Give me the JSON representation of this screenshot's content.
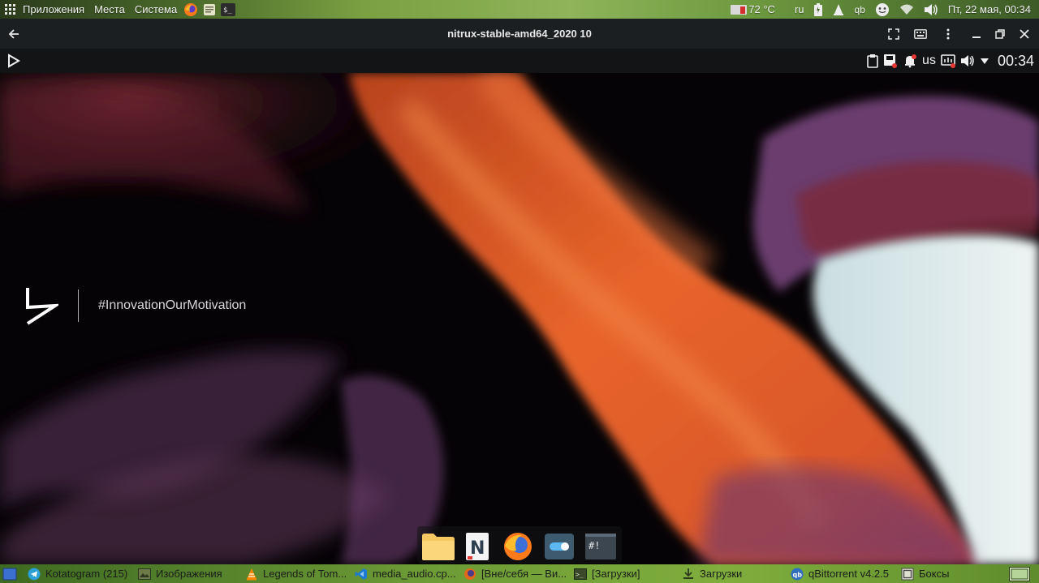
{
  "top_panel": {
    "menus": [
      "Приложения",
      "Места",
      "Система"
    ],
    "temperature": "72 °C",
    "keyboard_layout": "ru",
    "qbittorrent": "qb",
    "datetime": "Пт, 22 мая, 00:34"
  },
  "titlebar": {
    "title": "nitrux-stable-amd64_2020 10"
  },
  "guest_panel": {
    "keyboard_layout": "us",
    "clock": "00:34"
  },
  "desktop": {
    "tagline": "#InnovationOurMotivation"
  },
  "dock": {
    "items": [
      "folder",
      "notes",
      "firefox",
      "toggle",
      "terminal"
    ]
  },
  "taskbar": {
    "tasks": [
      {
        "label": "Kotatogram (215)",
        "icon": "telegram-icon"
      },
      {
        "label": "Изображения",
        "icon": "image-viewer-icon"
      },
      {
        "label": "Legends of Tom...",
        "icon": "vlc-icon"
      },
      {
        "label": "media_audio.cp...",
        "icon": "vscode-icon"
      },
      {
        "label": "[Вне/себя — Ви...",
        "icon": "firefox-icon"
      },
      {
        "label": "[Загрузки]",
        "icon": "terminal-icon"
      },
      {
        "label": "Загрузки",
        "icon": "download-icon"
      },
      {
        "label": "qBittorrent v4.2.5",
        "icon": "qbittorrent-icon"
      },
      {
        "label": "Боксы",
        "icon": "boxes-icon"
      }
    ]
  },
  "colors": {
    "panel_green": "#7aa042",
    "titlebar_bg": "#1c1f21",
    "flame_orange": "#e8642a",
    "purple": "#6a3d6e"
  }
}
